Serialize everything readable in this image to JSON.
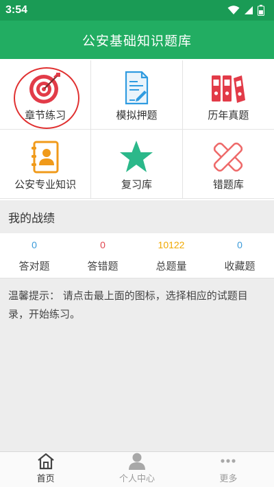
{
  "status_bar": {
    "time": "3:54"
  },
  "header": {
    "title": "公安基础知识题库"
  },
  "menu": [
    {
      "label": "章节练习",
      "icon": "target-icon"
    },
    {
      "label": "模拟押题",
      "icon": "document-pen-icon"
    },
    {
      "label": "历年真题",
      "icon": "binders-icon"
    },
    {
      "label": "公安专业知识",
      "icon": "contact-book-icon"
    },
    {
      "label": "复习库",
      "icon": "star-icon"
    },
    {
      "label": "错题库",
      "icon": "cross-icon"
    }
  ],
  "record": {
    "title": "我的战绩",
    "stats": [
      {
        "value": "0",
        "label": "答对题",
        "color": "#3a9ad9"
      },
      {
        "value": "0",
        "label": "答错题",
        "color": "#e0454e"
      },
      {
        "value": "10122",
        "label": "总题量",
        "color": "#f0a800"
      },
      {
        "value": "0",
        "label": "收藏题",
        "color": "#3a9ad9"
      }
    ]
  },
  "tips": "温馨提示： 请点击最上面的图标，选择相应的试题目录，开始练习。",
  "nav": [
    {
      "label": "首页",
      "icon": "home-icon",
      "active": true
    },
    {
      "label": "个人中心",
      "icon": "person-icon",
      "active": false
    },
    {
      "label": "更多",
      "icon": "more-dots-icon",
      "active": false
    }
  ],
  "colors": {
    "status_bar": "#1a9b55",
    "header": "#22ad62",
    "highlight_ring": "#e03030",
    "nav_active": "#333333",
    "nav_inactive": "#9a9a9a"
  }
}
